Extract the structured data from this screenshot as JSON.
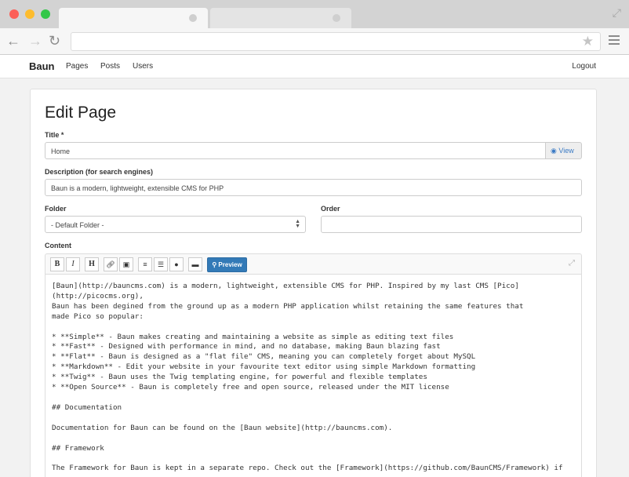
{
  "browser": {
    "url": "",
    "icons": {
      "back": "arrow-left-icon",
      "forward": "arrow-right-icon",
      "reload": "reload-icon",
      "bookmark": "star-icon",
      "menu": "hamburger-menu-icon",
      "fullscreen": "expand-icon"
    }
  },
  "navbar": {
    "brand": "Baun",
    "links": [
      "Pages",
      "Posts",
      "Users"
    ],
    "logout": "Logout"
  },
  "page": {
    "title": "Edit Page",
    "title_label": "Title *",
    "title_value": "Home",
    "view_label": "View",
    "description_label": "Description (for search engines)",
    "description_value": "Baun is a modern, lightweight, extensible CMS for PHP",
    "folder_label": "Folder",
    "folder_value": "- Default Folder -",
    "order_label": "Order",
    "order_value": "",
    "content_label": "Content"
  },
  "editor": {
    "toolbar": {
      "bold": "B",
      "italic": "I",
      "header": "H",
      "link": "link-icon",
      "image": "image-icon",
      "unordered_list": "list-icon",
      "ordered_list": "ordered-list-icon",
      "code": "code-icon",
      "quote": "quote-icon",
      "preview": "Preview"
    },
    "content": "[Baun](http://bauncms.com) is a modern, lightweight, extensible CMS for PHP. Inspired by my last CMS [Pico]\n(http://picocms.org),\nBaun has been degined from the ground up as a modern PHP application whilst retaining the same features that\nmade Pico so popular:\n\n* **Simple** - Baun makes creating and maintaining a website as simple as editing text files\n* **Fast** - Designed with performance in mind, and no database, making Baun blazing fast\n* **Flat** - Baun is designed as a \"flat file\" CMS, meaning you can completely forget about MySQL\n* **Markdown** - Edit your website in your favourite text editor using simple Markdown formatting\n* **Twig** - Baun uses the Twig templating engine, for powerful and flexible templates\n* **Open Source** - Baun is completely free and open source, released under the MIT license\n\n## Documentation\n\nDocumentation for Baun can be found on the [Baun website](http://bauncms.com).\n\n## Framework\n\nThe Framework for Baun is kept in a separate repo. Check out the [Framework](https://github.com/BaunCMS/Framework) if"
  },
  "colors": {
    "primary": "#337ab7",
    "link": "#3b7bc5",
    "chrome": "#d3d3d3"
  }
}
